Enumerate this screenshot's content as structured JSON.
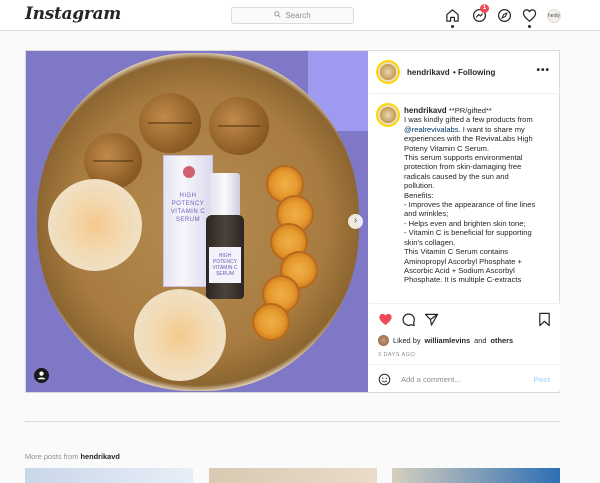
{
  "topbar": {
    "logo": "Instagram",
    "search_placeholder": "Search",
    "notification_count": "1",
    "profile_avatar_text": "heidy"
  },
  "post": {
    "username": "hendrikavd",
    "follow_status": "• Following",
    "media_box_text": [
      "HIGH",
      "POTENCY",
      "VITAMIN C",
      "SERUM"
    ],
    "media_bottle_text": [
      "HIGH POTENCY",
      "VITAMIN C",
      "SERUM"
    ],
    "caption": {
      "author": "hendrikavd",
      "lines": [
        {
          "pre": " **PR/gifted**"
        },
        {
          "text": "I was kindly gifted a few products from"
        },
        {
          "link": "@realrevivalabs",
          "text": ". I want to share my"
        },
        {
          "text": "experiences with the RevivaLabs High"
        },
        {
          "text": "Poteny Vitamin C Serum."
        },
        {
          "text": "This serum supports environmental"
        },
        {
          "text": "protection from skin-damaging free"
        },
        {
          "text": "radicals caused by the sun and"
        },
        {
          "text": "pollution."
        },
        {
          "text": "Benefits:"
        },
        {
          "text": "- Improves the appearance of fine lines"
        },
        {
          "text": "and wrinkles;"
        },
        {
          "text": "- Helps even and brighten skin tone;"
        },
        {
          "text": "- Vitamin C is beneficial for supporting"
        },
        {
          "text": "skin's collagen."
        },
        {
          "text": "This Vitamin C Serum contains"
        },
        {
          "text": "Aminopropyl Ascorbyl Phosphate +"
        },
        {
          "text": "Ascorbic Acid + Sodium Ascorbyl"
        },
        {
          "text": "Phosphate. It is multiple C-extracts"
        }
      ]
    },
    "liked_by_prefix": "Liked by",
    "liked_by_user": "williamlevins",
    "liked_by_suffix": "and",
    "liked_by_others": "others",
    "date": "3 DAYS AGO",
    "comment_placeholder": "Add a comment...",
    "post_button": "Post",
    "like_color": "#ed4956"
  },
  "more_posts": {
    "prefix": "More posts from",
    "username": "hendrikavd"
  },
  "icons": [
    "search-icon",
    "home-icon",
    "messenger-icon",
    "explore-icon",
    "heart-icon",
    "more-icon",
    "chevron-right-icon",
    "user-tag-icon",
    "like-icon",
    "comment-icon",
    "share-icon",
    "bookmark-icon",
    "emoji-icon"
  ]
}
